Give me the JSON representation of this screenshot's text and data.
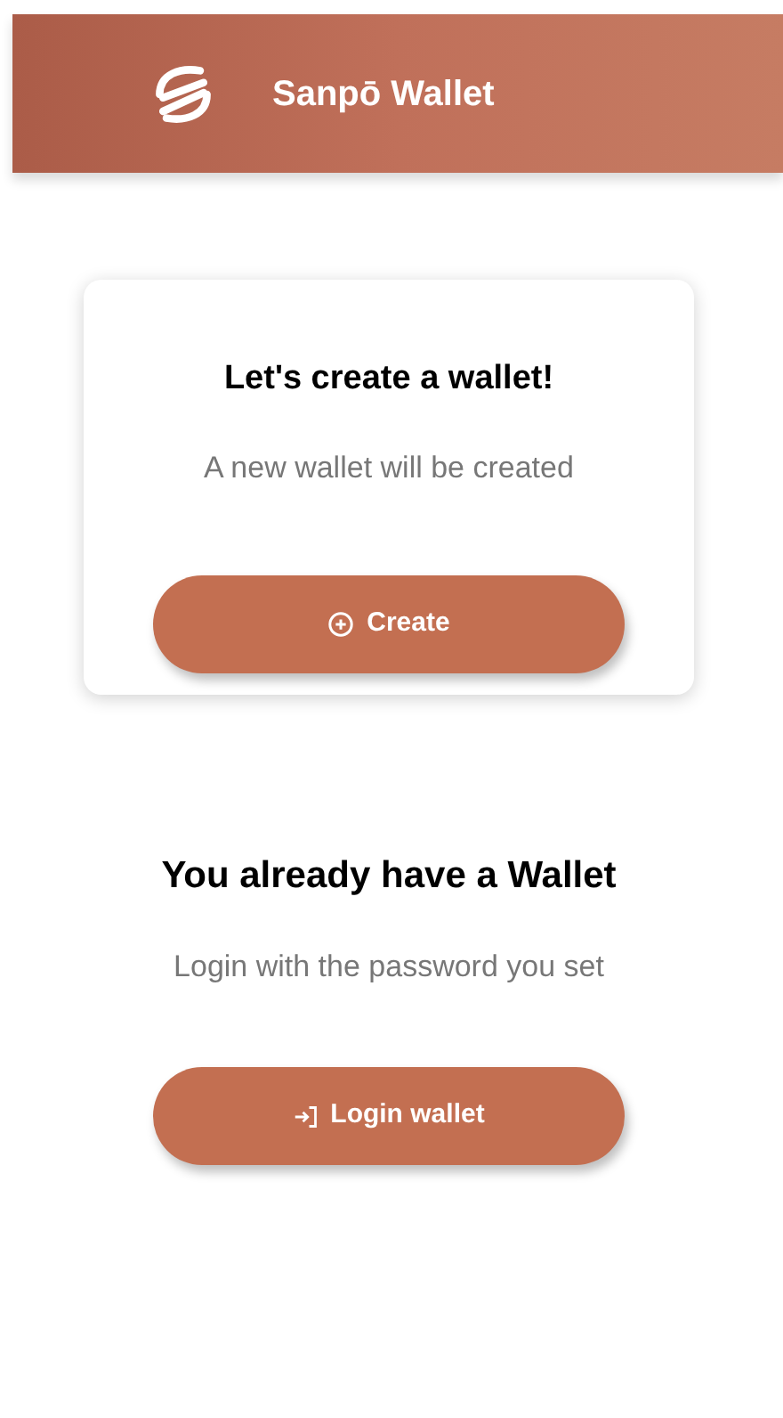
{
  "header": {
    "title": "Sanpō Wallet"
  },
  "create_card": {
    "title": "Let's create a wallet!",
    "subtitle": "A new wallet will be created",
    "button": "Create"
  },
  "login_section": {
    "title": "You already have a Wallet",
    "subtitle": "Login with the password you set",
    "button": "Login wallet"
  }
}
